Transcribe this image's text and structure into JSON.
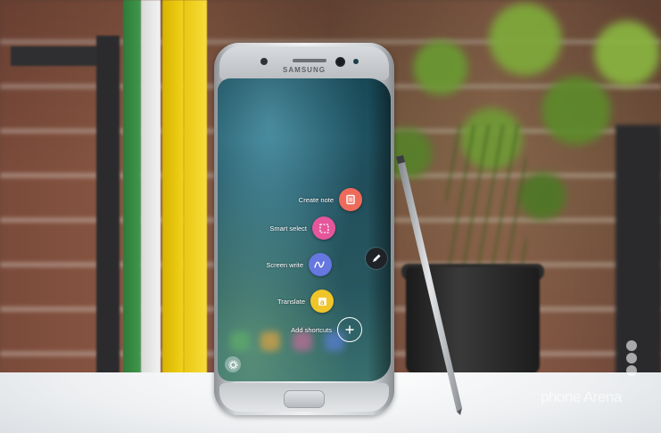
{
  "phone": {
    "brand": "SAMSUNG"
  },
  "air_command": {
    "items": [
      {
        "label": "Create note",
        "icon": "note-icon",
        "color": "#ef6a5b"
      },
      {
        "label": "Smart select",
        "icon": "smart-select-icon",
        "color": "#e5569a"
      },
      {
        "label": "Screen write",
        "icon": "screen-write-icon",
        "color": "#6677e0"
      },
      {
        "label": "Translate",
        "icon": "translate-icon",
        "color": "#f0c52a"
      },
      {
        "label": "Add shortcuts",
        "icon": "plus-icon",
        "color": "transparent"
      }
    ],
    "pen_icon": "pen-icon",
    "settings_icon": "gear-icon"
  },
  "watermark": {
    "text": "phone Arena"
  }
}
